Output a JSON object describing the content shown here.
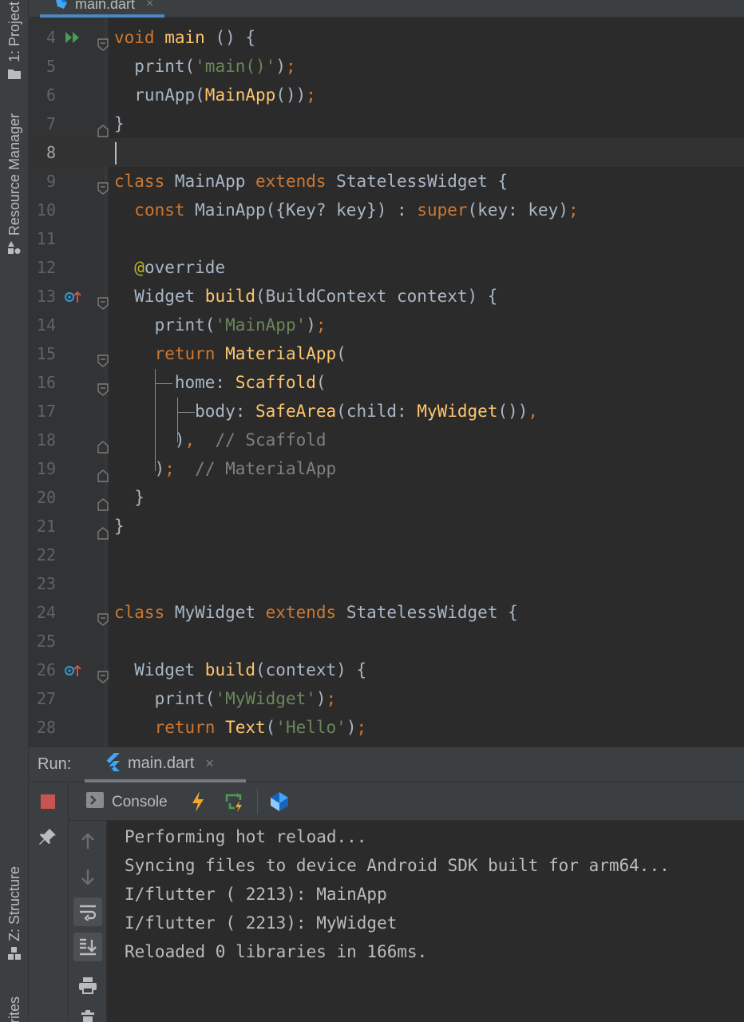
{
  "editor_tab": {
    "label": "main.dart",
    "close": "×"
  },
  "left_strip": {
    "project": "1: Project",
    "resource_manager": "Resource Manager",
    "structure": "Z: Structure",
    "favorites": "Favorites"
  },
  "code": [
    {
      "n": "4",
      "html": "<span class=\"kw\">void</span> <span class=\"fn\">main</span> () {"
    },
    {
      "n": "5",
      "html": "  print(<span class=\"str\">'main()'</span>)<span class=\"pun\">;</span>"
    },
    {
      "n": "6",
      "html": "  runApp(<span class=\"fn\">MainApp</span>())<span class=\"pun\">;</span>"
    },
    {
      "n": "7",
      "html": "}"
    },
    {
      "n": "8",
      "html": ""
    },
    {
      "n": "9",
      "html": "<span class=\"kw\">class</span> MainApp <span class=\"kw\">extends</span> StatelessWidget {"
    },
    {
      "n": "10",
      "html": "  <span class=\"kw\">const</span> MainApp({Key? key}) : <span class=\"kw\">super</span>(key: key)<span class=\"pun\">;</span>"
    },
    {
      "n": "11",
      "html": ""
    },
    {
      "n": "12",
      "html": "  <span class=\"ann\">@</span>override"
    },
    {
      "n": "13",
      "html": "  Widget <span class=\"fn\">build</span>(BuildContext context) {"
    },
    {
      "n": "14",
      "html": "    print(<span class=\"str\">'MainApp'</span>)<span class=\"pun\">;</span>"
    },
    {
      "n": "15",
      "html": "    <span class=\"kw\">return</span> <span class=\"fn\">MaterialApp</span>("
    },
    {
      "n": "16",
      "html": "      home: <span class=\"fn\">Scaffold</span>("
    },
    {
      "n": "17",
      "html": "        body: <span class=\"fn\">SafeArea</span>(child: <span class=\"fn\">MyWidget</span>())<span class=\"pun\">,</span>"
    },
    {
      "n": "18",
      "html": "      )<span class=\"pun\">,</span>  <span class=\"cm\">// Scaffold</span>"
    },
    {
      "n": "19",
      "html": "    )<span class=\"pun\">;</span>  <span class=\"cm\">// MaterialApp</span>"
    },
    {
      "n": "20",
      "html": "  }"
    },
    {
      "n": "21",
      "html": "}"
    },
    {
      "n": "22",
      "html": ""
    },
    {
      "n": "23",
      "html": ""
    },
    {
      "n": "24",
      "html": "<span class=\"kw\">class</span> MyWidget <span class=\"kw\">extends</span> StatelessWidget {"
    },
    {
      "n": "25",
      "html": ""
    },
    {
      "n": "26",
      "html": "  Widget <span class=\"fn\">build</span>(context) {"
    },
    {
      "n": "27",
      "html": "    print(<span class=\"str\">'MyWidget'</span>)<span class=\"pun\">;</span>"
    },
    {
      "n": "28",
      "html": "    <span class=\"kw\">return</span> <span class=\"fn\">Text</span>(<span class=\"str\">'Hello'</span>)<span class=\"pun\">;</span>"
    }
  ],
  "current_line": "8",
  "run_panel": {
    "title": "Run:",
    "tab_label": "main.dart",
    "tab_close": "×",
    "console_label": "Console"
  },
  "console_output": [
    "Performing hot reload...",
    "Syncing files to device Android SDK built for arm64...",
    "I/flutter ( 2213): MainApp",
    "I/flutter ( 2213): MyWidget",
    "Reloaded 0 libraries in 166ms."
  ],
  "colors": {
    "keyword": "#cc7832",
    "function": "#ffc66d",
    "string": "#6a8759",
    "comment": "#808080",
    "annotation": "#bbb529",
    "stop": "#c75450",
    "flutter_blue": "#42a5f5",
    "run_green": "#499c54",
    "hot_reload": "#f0a732"
  }
}
